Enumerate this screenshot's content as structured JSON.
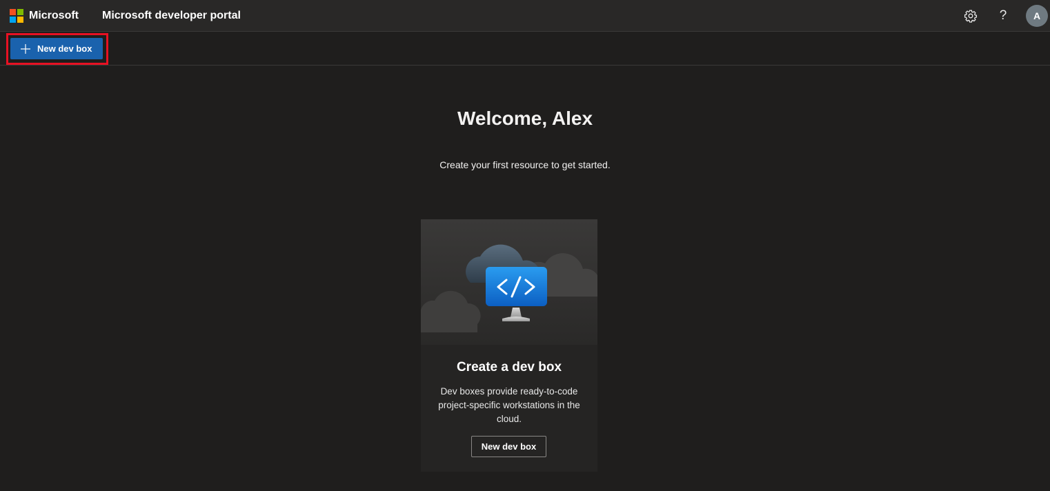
{
  "header": {
    "brand": "Microsoft",
    "title": "Microsoft developer portal",
    "settings_icon": "gear-icon",
    "help_icon": "question-mark-icon",
    "avatar_initial": "A"
  },
  "toolbar": {
    "new_dev_box_label": "New dev box",
    "new_dev_box_icon": "plus-icon"
  },
  "main": {
    "welcome": "Welcome, Alex",
    "subtitle": "Create your first resource to get started."
  },
  "card": {
    "illustration": "cloud-monitor-code-icon",
    "title": "Create a dev box",
    "description": "Dev boxes provide ready-to-code project-specific workstations in the cloud.",
    "button_label": "New dev box"
  },
  "colors": {
    "accent": "#1a62ad",
    "highlight": "#e81123",
    "background": "#1f1e1d",
    "header": "#292827",
    "ms_red": "#f25022",
    "ms_green": "#7fba00",
    "ms_blue": "#00a4ef",
    "ms_yellow": "#ffb900"
  }
}
